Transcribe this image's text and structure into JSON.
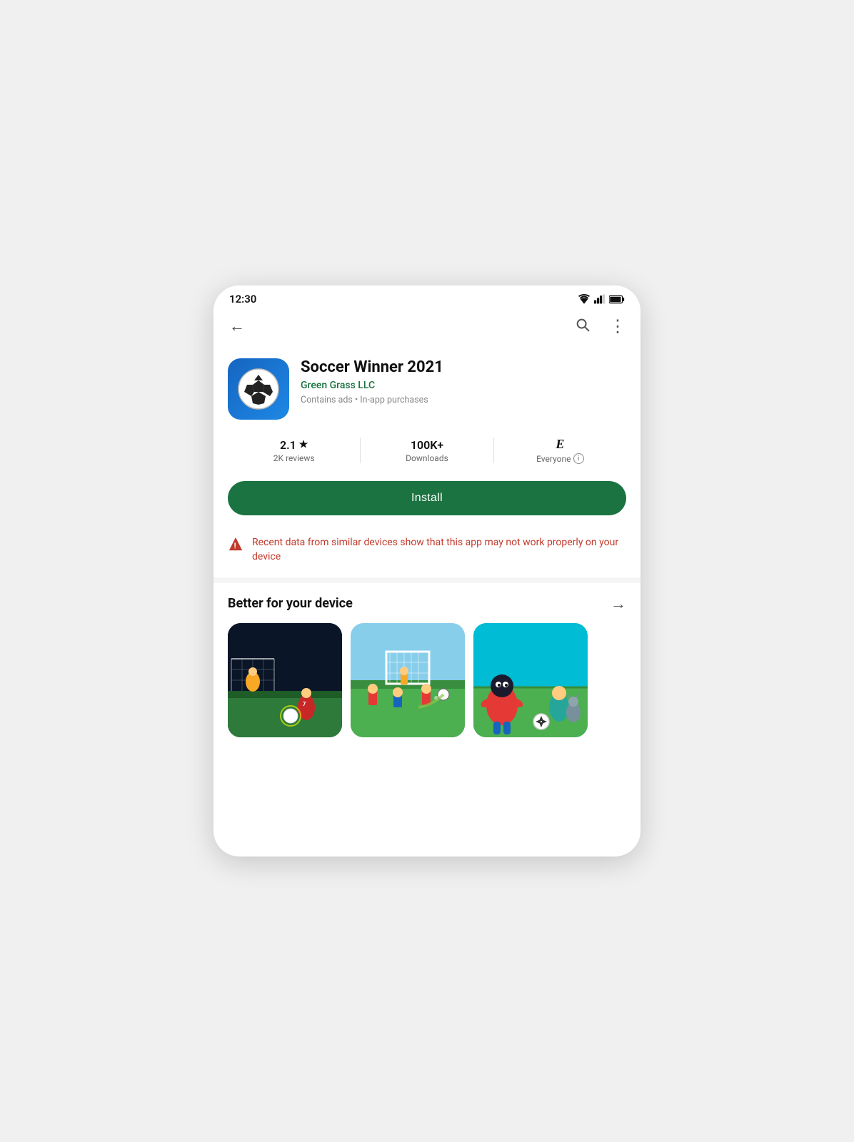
{
  "statusBar": {
    "time": "12:30"
  },
  "nav": {
    "back_label": "←",
    "search_label": "🔍",
    "more_label": "⋮"
  },
  "app": {
    "title": "Soccer Winner 2021",
    "developer": "Green Grass LLC",
    "meta": "Contains ads  •  In-app purchases",
    "rating": "2.1",
    "star": "★",
    "reviews": "2K reviews",
    "downloads": "100K+",
    "downloads_label": "Downloads",
    "rating_label": "Everyone",
    "rating_e": "E",
    "info_i": "i"
  },
  "install": {
    "label": "Install"
  },
  "warning": {
    "text": "Recent data from similar devices show that this app may not work properly on your device"
  },
  "better": {
    "title": "Better for your device",
    "arrow": "→"
  },
  "thumbnails": [
    {
      "id": "thumb1",
      "alt": "Soccer game night"
    },
    {
      "id": "thumb2",
      "alt": "Soccer pixel game"
    },
    {
      "id": "thumb3",
      "alt": "Soccer cartoon game"
    }
  ]
}
